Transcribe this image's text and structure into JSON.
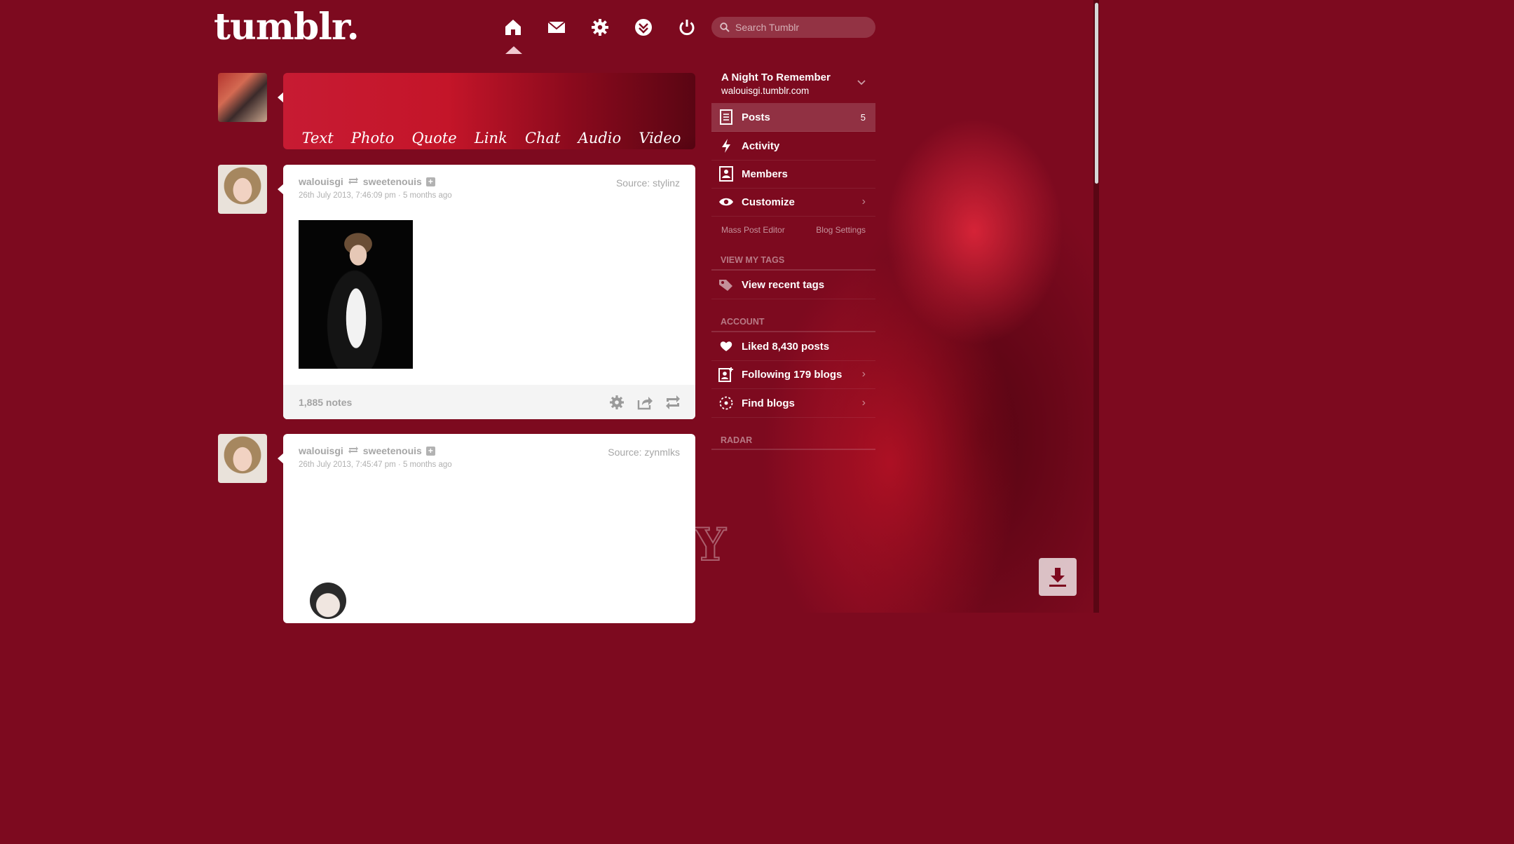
{
  "app": {
    "logo_text": "tumblr."
  },
  "nav": {
    "items": [
      {
        "icon": "home-icon",
        "active": true
      },
      {
        "icon": "mail-icon"
      },
      {
        "icon": "gear-icon"
      },
      {
        "icon": "explore-icon"
      },
      {
        "icon": "power-icon"
      }
    ]
  },
  "search": {
    "placeholder": "Search Tumblr",
    "value": ""
  },
  "composer": {
    "post_types": [
      "Text",
      "Photo",
      "Quote",
      "Link",
      "Chat",
      "Audio",
      "Video"
    ]
  },
  "posts": [
    {
      "user": "walouisgi",
      "reblogged_from": "sweetenouis",
      "date": "26th July 2013, 7:46:09 pm · 5 months ago",
      "source": "Source: stylinz",
      "notes": "1,885 notes"
    },
    {
      "user": "walouisgi",
      "reblogged_from": "sweetenouis",
      "date": "26th July 2013, 7:45:47 pm · 5 months ago",
      "source": "Source: zynmlks"
    }
  ],
  "sidebar": {
    "blog_title": "A Night To Remember",
    "blog_url": "walouisgi.tumblr.com",
    "menu": [
      {
        "label": "Posts",
        "count": "5",
        "icon": "document-icon"
      },
      {
        "label": "Activity",
        "icon": "lightning-icon"
      },
      {
        "label": "Members",
        "icon": "members-icon"
      },
      {
        "label": "Customize",
        "icon": "eye-icon"
      }
    ],
    "mass_post_editor": "Mass Post Editor",
    "blog_settings": "Blog Settings",
    "tags_header": "VIEW MY TAGS",
    "recent_tags": "View recent tags",
    "account_header": "ACCOUNT",
    "account": [
      {
        "label": "Liked 8,430 posts",
        "icon": "heart-icon"
      },
      {
        "label": "Following 179 blogs",
        "icon": "following-icon"
      },
      {
        "label": "Find blogs",
        "icon": "find-icon"
      }
    ],
    "radar_header": "RADAR"
  },
  "colors": {
    "background": "#7d0a1f",
    "accent": "#c71b33"
  }
}
